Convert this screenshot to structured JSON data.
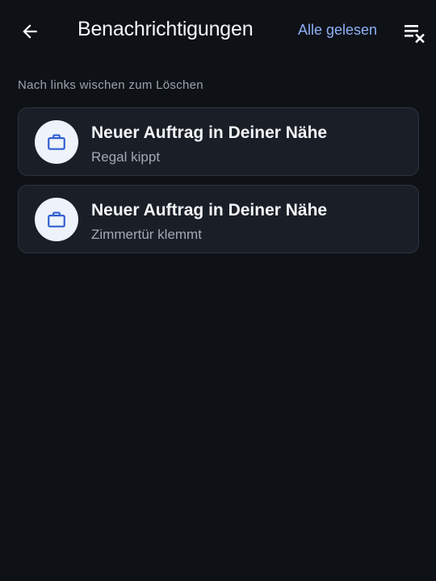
{
  "header": {
    "back_icon": "arrow-left-icon",
    "title": "Benachrichtigungen",
    "mark_all_read": "Alle gelesen",
    "clear_icon": "clear-all-icon"
  },
  "hint": "Nach links wischen zum Löschen",
  "notifications": [
    {
      "icon": "briefcase-icon",
      "title": "Neuer Auftrag in Deiner Nähe",
      "subtitle": "Regal kippt"
    },
    {
      "icon": "briefcase-icon",
      "title": "Neuer Auftrag in Deiner Nähe",
      "subtitle": "Zimmertür klemmt"
    }
  ],
  "colors": {
    "background": "#0e1217",
    "card": "#1a1f27",
    "accent_link": "#8fb0f5",
    "icon_blue": "#2f5fd0"
  }
}
